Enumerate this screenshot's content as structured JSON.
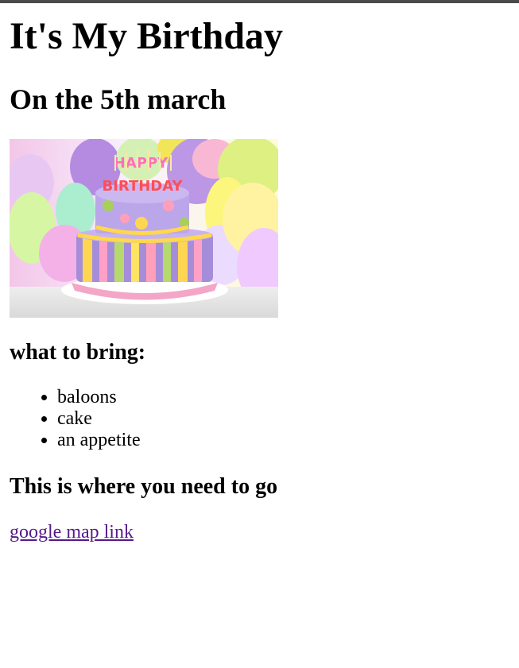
{
  "page": {
    "title": "It's My Birthday",
    "date_heading": "On the 5th march",
    "image_description": "birthday cake with candles spelling HAPPY BIRTHDAY in front of balloons",
    "image_text": "HAPPY BIRTHDAY",
    "bring_heading": "what to bring:",
    "bring_items": [
      "baloons",
      "cake",
      "an appetite"
    ],
    "where_heading": "This is where you need to go",
    "map_link_label": "google map link"
  },
  "colors": {
    "top_bar": "#4a4a4a",
    "link_visited": "#551a8b"
  }
}
